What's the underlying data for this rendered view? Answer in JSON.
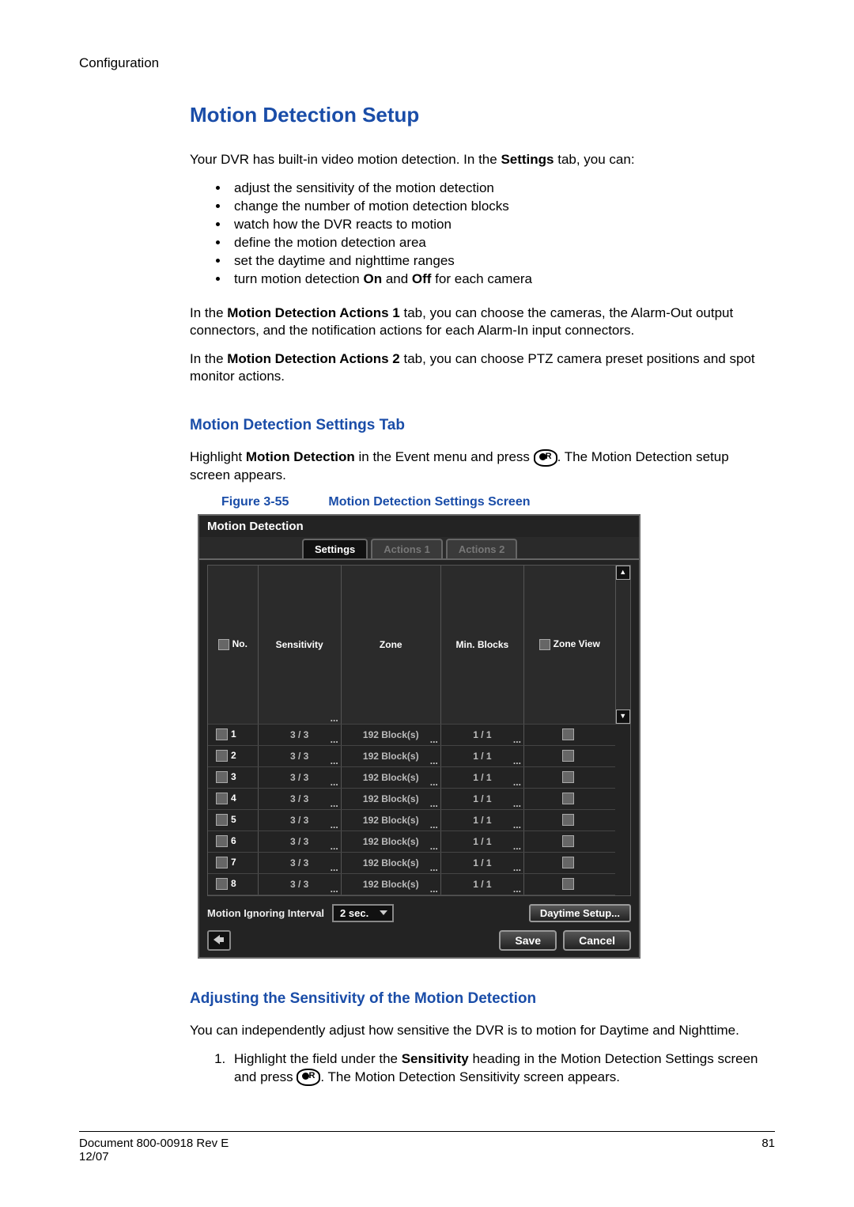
{
  "header": {
    "section": "Configuration"
  },
  "main_title": "Motion Detection Setup",
  "intro": {
    "text_before": "Your DVR has built-in video motion detection. In the ",
    "bold": "Settings",
    "text_after": " tab, you can:"
  },
  "bullets": [
    "adjust the sensitivity of the motion detection",
    "change the number of motion detection blocks",
    "watch how the DVR reacts to motion",
    "define the motion detection area",
    "set the daytime and nighttime ranges"
  ],
  "bullet_last": {
    "before": "turn motion detection ",
    "b1": "On",
    "mid": " and ",
    "b2": "Off",
    "after": " for each camera"
  },
  "para_actions1": {
    "before": "In the ",
    "bold": "Motion Detection Actions 1",
    "after": " tab, you can choose the cameras, the Alarm-Out output connectors, and the notification actions for each Alarm-In input connectors."
  },
  "para_actions2": {
    "before": "In the ",
    "bold": "Motion Detection Actions 2",
    "after": " tab, you can choose PTZ camera preset positions and spot monitor actions."
  },
  "sub1": "Motion Detection Settings Tab",
  "sub1_text": {
    "before": "Highlight ",
    "bold": "Motion Detection",
    "mid": " in the Event menu and press ",
    "after": ". The Motion Detection setup screen appears."
  },
  "figure": {
    "num": "Figure 3-55",
    "caption": "Motion Detection Settings Screen"
  },
  "ui": {
    "title": "Motion Detection",
    "tabs": [
      "Settings",
      "Actions 1",
      "Actions 2"
    ],
    "columns": {
      "no": "No.",
      "sens": "Sensitivity",
      "zone": "Zone",
      "min": "Min. Blocks",
      "zoneview": "Zone View"
    },
    "rows": [
      {
        "n": "1",
        "sens": "3 / 3",
        "zone": "192 Block(s)",
        "min": "1 / 1"
      },
      {
        "n": "2",
        "sens": "3 / 3",
        "zone": "192 Block(s)",
        "min": "1 / 1"
      },
      {
        "n": "3",
        "sens": "3 / 3",
        "zone": "192 Block(s)",
        "min": "1 / 1"
      },
      {
        "n": "4",
        "sens": "3 / 3",
        "zone": "192 Block(s)",
        "min": "1 / 1"
      },
      {
        "n": "5",
        "sens": "3 / 3",
        "zone": "192 Block(s)",
        "min": "1 / 1"
      },
      {
        "n": "6",
        "sens": "3 / 3",
        "zone": "192 Block(s)",
        "min": "1 / 1"
      },
      {
        "n": "7",
        "sens": "3 / 3",
        "zone": "192 Block(s)",
        "min": "1 / 1"
      },
      {
        "n": "8",
        "sens": "3 / 3",
        "zone": "192 Block(s)",
        "min": "1 / 1"
      }
    ],
    "interval_label": "Motion Ignoring Interval",
    "interval_value": "2 sec.",
    "daytime": "Daytime Setup...",
    "save": "Save",
    "cancel": "Cancel"
  },
  "sub2": "Adjusting the Sensitivity of the Motion Detection",
  "sub2_intro": "You can independently adjust how sensitive the DVR is to motion for Daytime and Nighttime.",
  "step1": {
    "before": "Highlight the field under the ",
    "bold": "Sensitivity",
    "mid": " heading in the Motion Detection Settings screen and press ",
    "after": ". The Motion Detection Sensitivity screen appears."
  },
  "footer": {
    "doc": "Document 800-00918 Rev E",
    "date": "12/07",
    "page": "81"
  }
}
